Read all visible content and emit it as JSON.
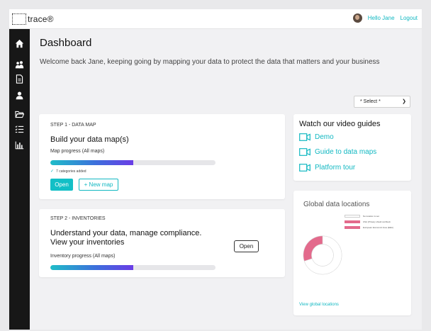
{
  "header": {
    "logo_text": "trace®",
    "greeting": "Hello Jane",
    "logout_label": "Logout"
  },
  "sidebar": {
    "items": [
      {
        "icon": "home-icon"
      },
      {
        "icon": "people-icon"
      },
      {
        "icon": "document-icon"
      },
      {
        "icon": "user-icon"
      },
      {
        "icon": "folder-icon"
      },
      {
        "icon": "checklist-icon"
      },
      {
        "icon": "bar-chart-icon"
      }
    ]
  },
  "page": {
    "title": "Dashboard",
    "welcome": "Welcome back Jane, keeping going by mapping your data to protect the data that matters and your business",
    "select_value": "* Select *"
  },
  "step1": {
    "label": "STEP 1 - DATA MAP",
    "heading": "Build your data map(s)",
    "progress_label": "Map progress (All maps)",
    "progress": 0.5,
    "note": "7 categories added",
    "open_label": "Open",
    "new_map_label": "+ New map"
  },
  "step2": {
    "label": "STEP 2 - INVENTORIES",
    "heading": "Understand your data, manage compliance. View your inventories",
    "progress_label": "Inventory progress (All maps)",
    "progress": 0.5,
    "open_label": "Open"
  },
  "videos": {
    "title": "Watch our video guides",
    "items": [
      {
        "label": "Demo"
      },
      {
        "label": "Guide to data maps"
      },
      {
        "label": "Platform tour"
      }
    ]
  },
  "global": {
    "title": "Global data locations",
    "legend": [
      {
        "label": "No location is set",
        "color": "#ffffff"
      },
      {
        "label": "USA (Privacy shield certified)",
        "color": "#e36a8c"
      },
      {
        "label": "European Economic Area (EEA)",
        "color": "#e36a8c"
      }
    ],
    "view_link": "View global locations"
  },
  "chart_data": {
    "type": "pie",
    "labels": [
      "No location is set",
      "USA (Privacy shield certified)",
      "European Economic Area (EEA)"
    ],
    "values": [
      70,
      0,
      30
    ],
    "colors": [
      "#ffffff",
      "#e36a8c",
      "#e36a8c"
    ]
  },
  "colors": {
    "accent": "#12b8c2",
    "sidebar": "#171717",
    "donut_pink": "#e36a8c"
  }
}
